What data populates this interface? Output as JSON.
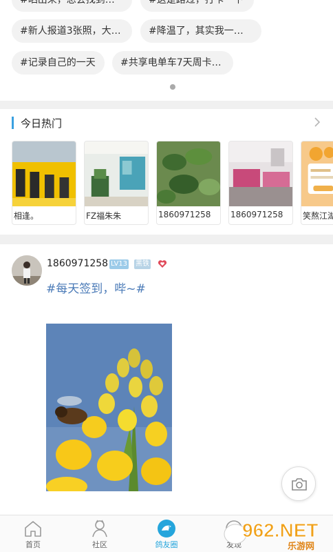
{
  "topics": {
    "row0": [
      "#晒出来，总会找到…",
      "#这是路过，打卡一下"
    ],
    "row1": [
      "#新人报道3张照，大…",
      "#降温了，其实我一…"
    ],
    "row2": [
      "#记录自己的一天",
      "#共享电单车7天周卡…"
    ]
  },
  "hot": {
    "title": "今日热门",
    "cards": [
      {
        "caption": "相逢。"
      },
      {
        "caption": "FZ福朱朱"
      },
      {
        "caption": "1860971258"
      },
      {
        "caption": "1860971258"
      },
      {
        "caption": "笑熬江湖"
      }
    ]
  },
  "post": {
    "username": "1860971258",
    "level": "LV13",
    "badge": "黑铁",
    "text": "#每天签到，哔~#"
  },
  "tabs": [
    {
      "label": "首页"
    },
    {
      "label": "社区"
    },
    {
      "label": "鸽友圈"
    },
    {
      "label": "发现"
    }
  ],
  "watermark": {
    "brand": "962.NET",
    "sub": "乐游网"
  },
  "colors": {
    "accent": "#25a5dc",
    "link": "#4a7ab7",
    "heart": "#e04a5a"
  }
}
